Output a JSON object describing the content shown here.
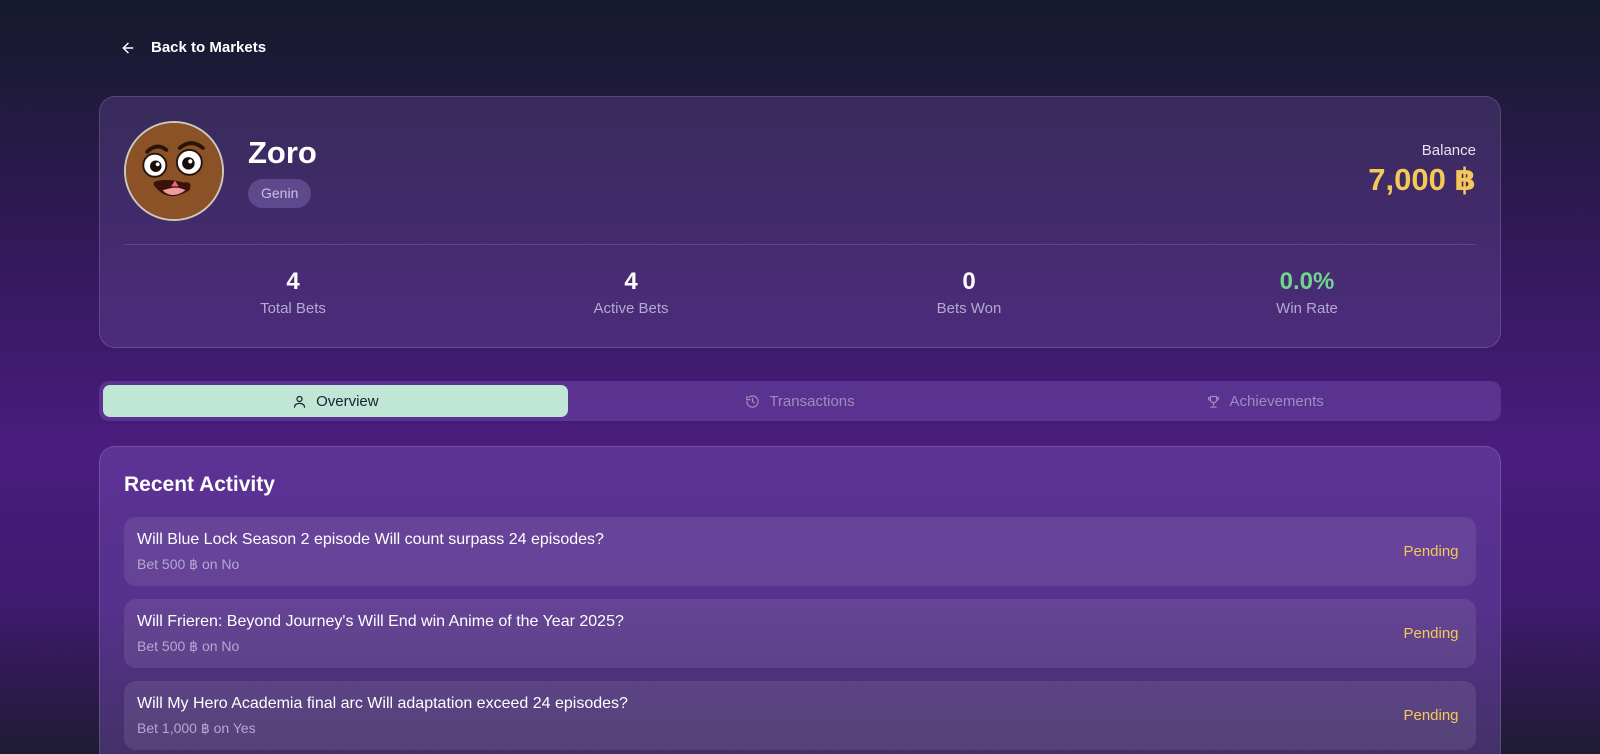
{
  "nav": {
    "back_label": "Back to Markets"
  },
  "profile": {
    "username": "Zoro",
    "rank": "Genin",
    "balance_label": "Balance",
    "balance_value": "7,000 ฿"
  },
  "stats": [
    {
      "value": "4",
      "label": "Total Bets"
    },
    {
      "value": "4",
      "label": "Active Bets"
    },
    {
      "value": "0",
      "label": "Bets Won"
    },
    {
      "value": "0.0%",
      "label": "Win Rate"
    }
  ],
  "tabs": [
    {
      "label": "Overview",
      "icon": "user-icon",
      "active": true
    },
    {
      "label": "Transactions",
      "icon": "history-icon",
      "active": false
    },
    {
      "label": "Achievements",
      "icon": "trophy-icon",
      "active": false
    }
  ],
  "activity": {
    "title": "Recent Activity",
    "items": [
      {
        "question": "Will Blue Lock Season 2 episode Will count surpass 24 episodes?",
        "detail": "Bet 500 ฿ on No",
        "status": "Pending"
      },
      {
        "question": "Will Frieren: Beyond Journey's Will End win Anime of the Year 2025?",
        "detail": "Bet 500 ฿ on No",
        "status": "Pending"
      },
      {
        "question": "Will My Hero Academia final arc Will adaptation exceed 24 episodes?",
        "detail": "Bet 1,000 ฿ on Yes",
        "status": "Pending"
      }
    ]
  },
  "colors": {
    "accent_gold": "#f5c85a",
    "win_green": "#6ed68c",
    "active_tab": "#c0e6d6"
  }
}
